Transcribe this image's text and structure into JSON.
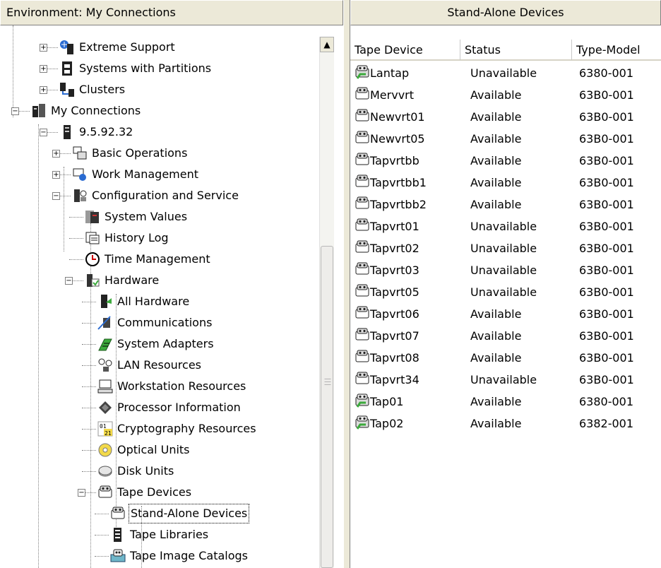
{
  "left_pane": {
    "title": "Environment: My Connections"
  },
  "right_pane": {
    "title": "Stand-Alone Devices"
  },
  "tree": {
    "items": [
      {
        "label": "Extreme Support",
        "icon": "extreme-support-icon",
        "expander": "+"
      },
      {
        "label": "Systems with Partitions",
        "icon": "partitions-icon",
        "expander": "+"
      },
      {
        "label": "Clusters",
        "icon": "clusters-icon",
        "expander": "+"
      },
      {
        "label": "My Connections",
        "icon": "connections-icon",
        "expander": "−"
      },
      {
        "label": "9.5.92.32",
        "icon": "server-icon",
        "expander": "−"
      },
      {
        "label": "Basic Operations",
        "icon": "basic-operations-icon",
        "expander": "+"
      },
      {
        "label": "Work Management",
        "icon": "work-management-icon",
        "expander": "+"
      },
      {
        "label": "Configuration and Service",
        "icon": "configuration-icon",
        "expander": "−"
      },
      {
        "label": "System Values",
        "icon": "system-values-icon",
        "expander": ""
      },
      {
        "label": "History Log",
        "icon": "history-log-icon",
        "expander": ""
      },
      {
        "label": "Time Management",
        "icon": "clock-icon",
        "expander": ""
      },
      {
        "label": "Hardware",
        "icon": "hardware-icon",
        "expander": "−"
      },
      {
        "label": "All Hardware",
        "icon": "all-hardware-icon",
        "expander": ""
      },
      {
        "label": "Communications",
        "icon": "communications-icon",
        "expander": ""
      },
      {
        "label": "System Adapters",
        "icon": "system-adapters-icon",
        "expander": ""
      },
      {
        "label": "LAN Resources",
        "icon": "lan-resources-icon",
        "expander": ""
      },
      {
        "label": "Workstation Resources",
        "icon": "workstation-icon",
        "expander": ""
      },
      {
        "label": "Processor Information",
        "icon": "processor-icon",
        "expander": ""
      },
      {
        "label": "Cryptography Resources",
        "icon": "cryptography-icon",
        "expander": ""
      },
      {
        "label": "Optical Units",
        "icon": "optical-disc-icon",
        "expander": ""
      },
      {
        "label": "Disk Units",
        "icon": "disk-icon",
        "expander": ""
      },
      {
        "label": "Tape Devices",
        "icon": "tape-device-icon",
        "expander": "−"
      },
      {
        "label": "Stand-Alone Devices",
        "icon": "tape-device-icon",
        "expander": "",
        "selected": true
      },
      {
        "label": "Tape Libraries",
        "icon": "tape-library-icon",
        "expander": ""
      },
      {
        "label": "Tape Image Catalogs",
        "icon": "tape-catalog-icon",
        "expander": ""
      }
    ]
  },
  "list": {
    "columns": [
      "Tape Device",
      "Status",
      "Type-Model"
    ],
    "rows": [
      {
        "device": "Lantap",
        "status": "Unavailable",
        "type": "6380-001",
        "icon": "tape-drive-green-icon"
      },
      {
        "device": "Mervvrt",
        "status": "Available",
        "type": "63B0-001",
        "icon": "tape-drive-icon"
      },
      {
        "device": "Newvrt01",
        "status": "Available",
        "type": "63B0-001",
        "icon": "tape-drive-icon"
      },
      {
        "device": "Newvrt05",
        "status": "Available",
        "type": "63B0-001",
        "icon": "tape-drive-icon"
      },
      {
        "device": "Tapvrtbb",
        "status": "Available",
        "type": "63B0-001",
        "icon": "tape-drive-icon"
      },
      {
        "device": "Tapvrtbb1",
        "status": "Available",
        "type": "63B0-001",
        "icon": "tape-drive-icon"
      },
      {
        "device": "Tapvrtbb2",
        "status": "Available",
        "type": "63B0-001",
        "icon": "tape-drive-icon"
      },
      {
        "device": "Tapvrt01",
        "status": "Unavailable",
        "type": "63B0-001",
        "icon": "tape-drive-icon"
      },
      {
        "device": "Tapvrt02",
        "status": "Unavailable",
        "type": "63B0-001",
        "icon": "tape-drive-icon"
      },
      {
        "device": "Tapvrt03",
        "status": "Unavailable",
        "type": "63B0-001",
        "icon": "tape-drive-icon"
      },
      {
        "device": "Tapvrt05",
        "status": "Unavailable",
        "type": "63B0-001",
        "icon": "tape-drive-icon"
      },
      {
        "device": "Tapvrt06",
        "status": "Available",
        "type": "63B0-001",
        "icon": "tape-drive-icon"
      },
      {
        "device": "Tapvrt07",
        "status": "Available",
        "type": "63B0-001",
        "icon": "tape-drive-icon"
      },
      {
        "device": "Tapvrt08",
        "status": "Available",
        "type": "63B0-001",
        "icon": "tape-drive-icon"
      },
      {
        "device": "Tapvrt34",
        "status": "Unavailable",
        "type": "63B0-001",
        "icon": "tape-drive-icon"
      },
      {
        "device": "Tap01",
        "status": "Available",
        "type": "6380-001",
        "icon": "tape-drive-green-icon"
      },
      {
        "device": "Tap02",
        "status": "Available",
        "type": "6382-001",
        "icon": "tape-drive-green-icon"
      }
    ]
  },
  "colors": {
    "header_bg": "#ece9d8",
    "icon_gray": "#8a8a8a",
    "icon_green": "#3caa3c",
    "icon_dark": "#202020"
  }
}
